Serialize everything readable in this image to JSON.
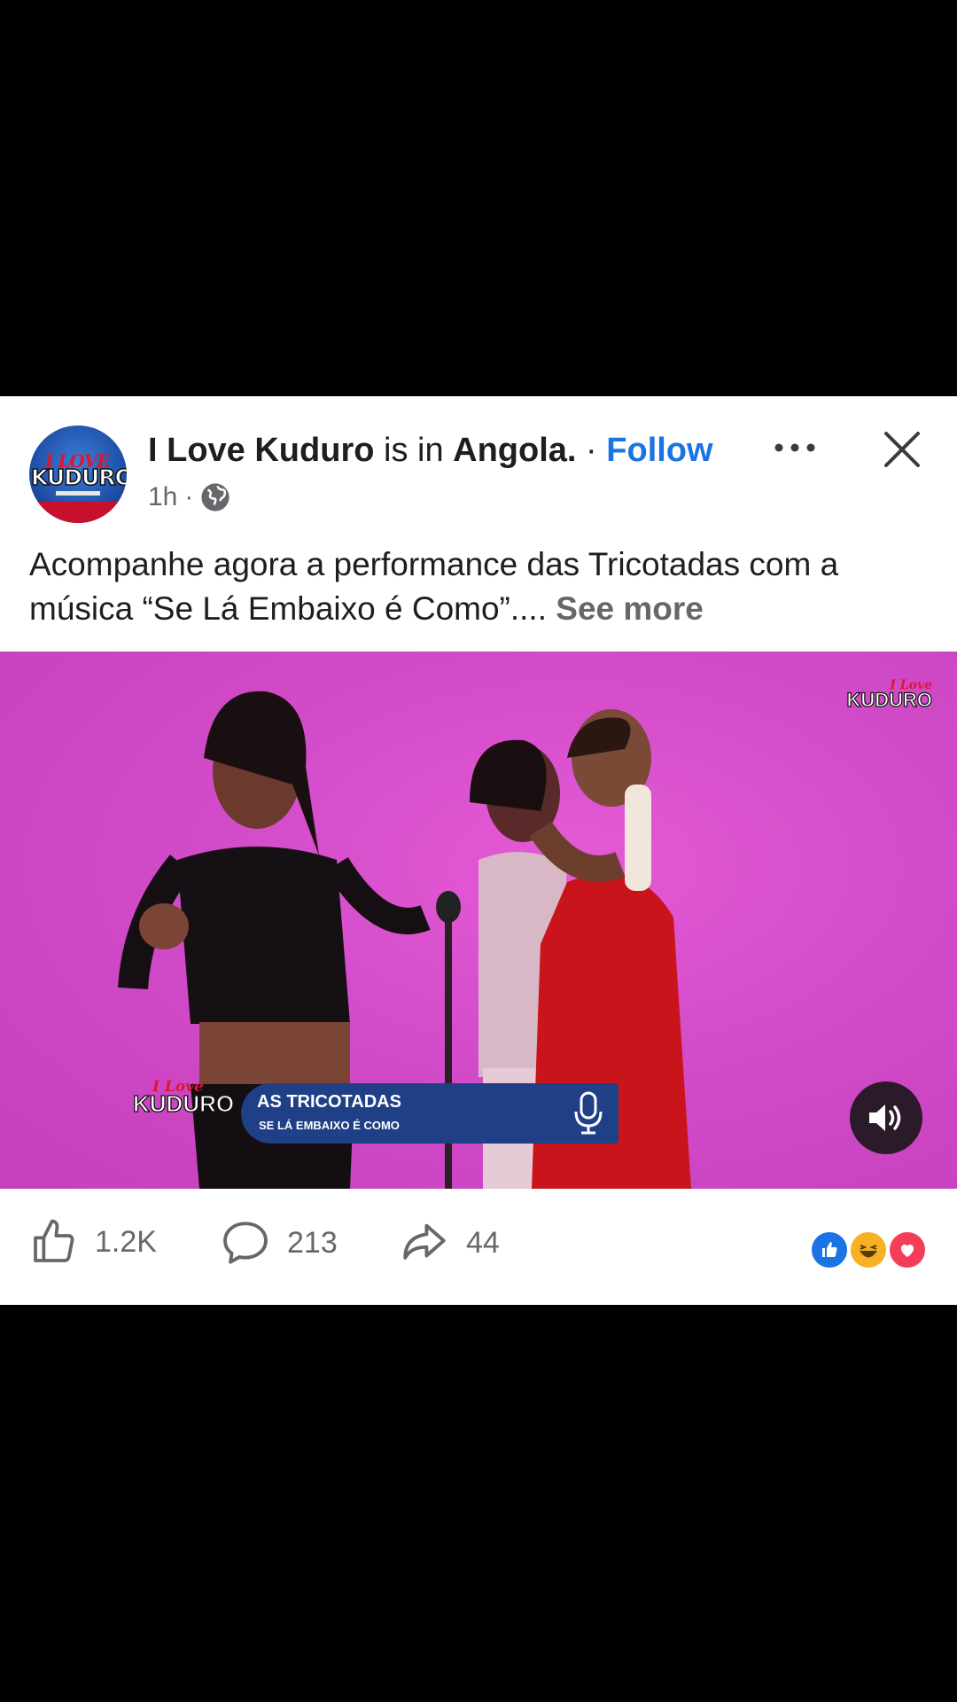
{
  "post": {
    "page_name": "I Love Kuduro",
    "is_in_text": " is in ",
    "location": "Angola.",
    "separator": " · ",
    "follow_label": "Follow",
    "time": "1h",
    "time_separator": "·",
    "caption": "Acompanhe agora a performance das Tricotadas com a música “Se Lá Embaixo é Como”....",
    "see_more": "See more"
  },
  "avatar": {
    "logo_top": "I LOVE",
    "logo_main": "KUDURO"
  },
  "video": {
    "watermark_top": "I Love",
    "watermark_main": "KUDURO",
    "lower_logo_top": "I Love",
    "lower_logo_main": "KUDURO",
    "lower_title": "AS TRICOTADAS",
    "lower_subtitle": "SE LÁ EMBAIXO É COMO",
    "colors": {
      "background": "#d24bc9",
      "lower_bar": "#1f3f86"
    }
  },
  "actions": {
    "likes": "1.2K",
    "comments": "213",
    "shares": "44"
  },
  "reactions": [
    "like-reaction",
    "haha-reaction",
    "love-reaction"
  ],
  "colors": {
    "accent": "#1b74e4",
    "secondary_text": "#65676b"
  }
}
